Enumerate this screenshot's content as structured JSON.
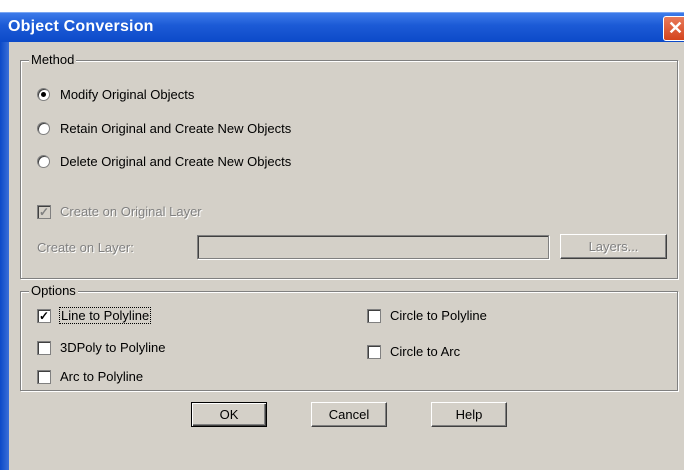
{
  "window": {
    "title": "Object Conversion",
    "close_glyph": "✕"
  },
  "method": {
    "legend": "Method",
    "options": [
      {
        "label": "Modify Original Objects",
        "selected": true
      },
      {
        "label": "Retain Original and Create New Objects",
        "selected": false
      },
      {
        "label": "Delete Original and Create New Objects",
        "selected": false
      }
    ],
    "create_on_original_layer": {
      "label": "Create on Original Layer",
      "checked": true,
      "enabled": false
    },
    "create_on_layer": {
      "label": "Create on Layer:",
      "value": "",
      "enabled": false
    },
    "layers_button": "Layers..."
  },
  "options": {
    "legend": "Options",
    "left": [
      {
        "label": "Line to Polyline",
        "checked": true
      },
      {
        "label": "3DPoly to Polyline",
        "checked": false
      },
      {
        "label": "Arc to Polyline",
        "checked": false
      }
    ],
    "right": [
      {
        "label": "Circle to Polyline",
        "checked": false
      },
      {
        "label": "Circle to Arc",
        "checked": false
      }
    ]
  },
  "buttons": {
    "ok": "OK",
    "cancel": "Cancel",
    "help": "Help"
  }
}
